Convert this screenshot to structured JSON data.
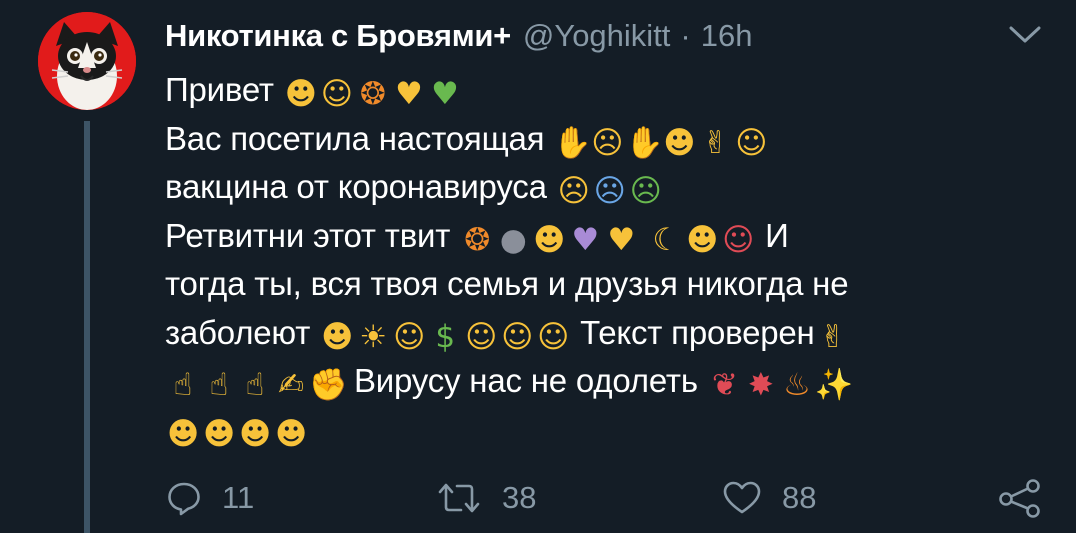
{
  "tweet": {
    "author": {
      "display_name": "Никотинка с Бровями+",
      "handle": "@Yoghikitt",
      "separator": "·",
      "time": "16h"
    },
    "lines": [
      {
        "segments": [
          {
            "type": "text",
            "value": "Привет "
          },
          {
            "type": "emoji",
            "icon": "grinning-face-emoji",
            "glyph": "☻",
            "color": "yellow"
          },
          {
            "type": "emoji",
            "icon": "smiling-blush-emoji",
            "glyph": "☺",
            "color": "yellow"
          },
          {
            "type": "emoji",
            "icon": "see-no-evil-monkey-emoji",
            "glyph": "❂",
            "color": "orange"
          },
          {
            "type": "emoji",
            "icon": "yellow-heart-emoji",
            "glyph": "♥",
            "color": "yellow"
          },
          {
            "type": "emoji",
            "icon": "green-heart-emoji",
            "glyph": "♥",
            "color": "green"
          }
        ]
      },
      {
        "segments": [
          {
            "type": "text",
            "value": "Вас посетила настоящая "
          },
          {
            "type": "emoji",
            "icon": "folded-hands-emoji",
            "glyph": "✋",
            "color": "yellow"
          },
          {
            "type": "emoji",
            "icon": "open-mouth-face-emoji",
            "glyph": "☹",
            "color": "yellow"
          },
          {
            "type": "emoji",
            "icon": "folded-hands-emoji",
            "glyph": "✋",
            "color": "yellow"
          },
          {
            "type": "emoji",
            "icon": "thinking-face-emoji",
            "glyph": "☻",
            "color": "yellow"
          },
          {
            "type": "emoji",
            "icon": "crossed-fingers-emoji",
            "glyph": "✌",
            "color": "yellow"
          },
          {
            "type": "emoji",
            "icon": "smiling-blush-emoji",
            "glyph": "☺",
            "color": "yellow"
          }
        ]
      },
      {
        "segments": [
          {
            "type": "text",
            "value": " вакцина от коронавируса "
          },
          {
            "type": "emoji",
            "icon": "zipper-mouth-face-emoji",
            "glyph": "☹",
            "color": "yellow"
          },
          {
            "type": "emoji",
            "icon": "screaming-face-emoji",
            "glyph": "☹",
            "color": "blue"
          },
          {
            "type": "emoji",
            "icon": "nauseated-face-emoji",
            "glyph": "☹",
            "color": "green"
          }
        ]
      },
      {
        "segments": [
          {
            "type": "text",
            "value": "Ретвитни этот твит "
          },
          {
            "type": "emoji",
            "icon": "see-no-evil-monkey-emoji",
            "glyph": "❂",
            "color": "orange"
          },
          {
            "type": "emoji",
            "icon": "new-moon-face-emoji",
            "glyph": "●",
            "color": "gray"
          },
          {
            "type": "emoji",
            "icon": "heart-eyes-cat-emoji",
            "glyph": "☻",
            "color": "yellow"
          },
          {
            "type": "emoji",
            "icon": "purple-heart-emoji",
            "glyph": "♥",
            "color": "purple"
          },
          {
            "type": "emoji",
            "icon": "yellow-heart-emoji",
            "glyph": "♥",
            "color": "yellow"
          },
          {
            "type": "text",
            "value": " "
          },
          {
            "type": "emoji",
            "icon": "crescent-moon-face-emoji",
            "glyph": "☾",
            "color": "yellow"
          },
          {
            "type": "emoji",
            "icon": "cowboy-face-emoji",
            "glyph": "☻",
            "color": "yellow"
          },
          {
            "type": "emoji",
            "icon": "clown-face-emoji",
            "glyph": "☺",
            "color": "red"
          },
          {
            "type": "text",
            "value": " И"
          }
        ]
      },
      {
        "segments": [
          {
            "type": "text",
            "value": "тогда ты, вся твоя семья и друзья никогда не"
          }
        ]
      },
      {
        "segments": [
          {
            "type": "text",
            "value": "заболеют "
          },
          {
            "type": "emoji",
            "icon": "grinning-face-emoji",
            "glyph": "☻",
            "color": "yellow"
          },
          {
            "type": "emoji",
            "icon": "sun-face-emoji",
            "glyph": "☀",
            "color": "yellow"
          },
          {
            "type": "emoji",
            "icon": "partying-face-emoji",
            "glyph": "☺",
            "color": "yellow"
          },
          {
            "type": "emoji",
            "icon": "money-mouth-face-emoji",
            "glyph": "$",
            "color": "green"
          },
          {
            "type": "emoji",
            "icon": "halo-face-emoji",
            "glyph": "☺",
            "color": "yellow"
          },
          {
            "type": "emoji",
            "icon": "halo-face-emoji",
            "glyph": "☺",
            "color": "yellow"
          },
          {
            "type": "emoji",
            "icon": "halo-face-emoji",
            "glyph": "☺",
            "color": "yellow"
          },
          {
            "type": "text",
            "value": " Текст проверен"
          },
          {
            "type": "emoji",
            "icon": "crossed-fingers-emoji",
            "glyph": "✌",
            "color": "yellow"
          }
        ]
      },
      {
        "segments": [
          {
            "type": "emoji",
            "icon": "pointing-up-emoji",
            "glyph": "☝",
            "color": "yellow"
          },
          {
            "type": "emoji",
            "icon": "pointing-up-emoji",
            "glyph": "☝",
            "color": "yellow"
          },
          {
            "type": "emoji",
            "icon": "pointing-up-emoji",
            "glyph": "☝",
            "color": "yellow"
          },
          {
            "type": "emoji",
            "icon": "writing-hand-emoji",
            "glyph": "✍",
            "color": "yellow"
          },
          {
            "type": "emoji",
            "icon": "flexed-biceps-emoji",
            "glyph": "✊",
            "color": "yellow"
          },
          {
            "type": "text",
            "value": " Вирусу нас не одолеть "
          },
          {
            "type": "emoji",
            "icon": "brain-emoji",
            "glyph": "❦",
            "color": "red"
          },
          {
            "type": "emoji",
            "icon": "collision-emoji",
            "glyph": "✸",
            "color": "red"
          },
          {
            "type": "emoji",
            "icon": "fire-emoji",
            "glyph": "♨",
            "color": "orange"
          },
          {
            "type": "emoji",
            "icon": "sparkles-emoji",
            "glyph": "✨",
            "color": "yellow"
          }
        ]
      },
      {
        "segments": [
          {
            "type": "emoji",
            "icon": "nerd-face-emoji",
            "glyph": "☻",
            "color": "yellow"
          },
          {
            "type": "emoji",
            "icon": "sunglasses-face-emoji",
            "glyph": "☻",
            "color": "yellow"
          },
          {
            "type": "emoji",
            "icon": "sunglasses-face-emoji",
            "glyph": "☻",
            "color": "yellow"
          },
          {
            "type": "emoji",
            "icon": "sunglasses-face-emoji",
            "glyph": "☻",
            "color": "yellow"
          }
        ]
      }
    ],
    "actions": {
      "reply_count": "11",
      "retweet_count": "38",
      "like_count": "88"
    }
  },
  "colors": {
    "background": "#141d26",
    "secondary_text": "#8899a6",
    "thread_line": "#3d5466",
    "avatar_background": "#e11b1b"
  }
}
